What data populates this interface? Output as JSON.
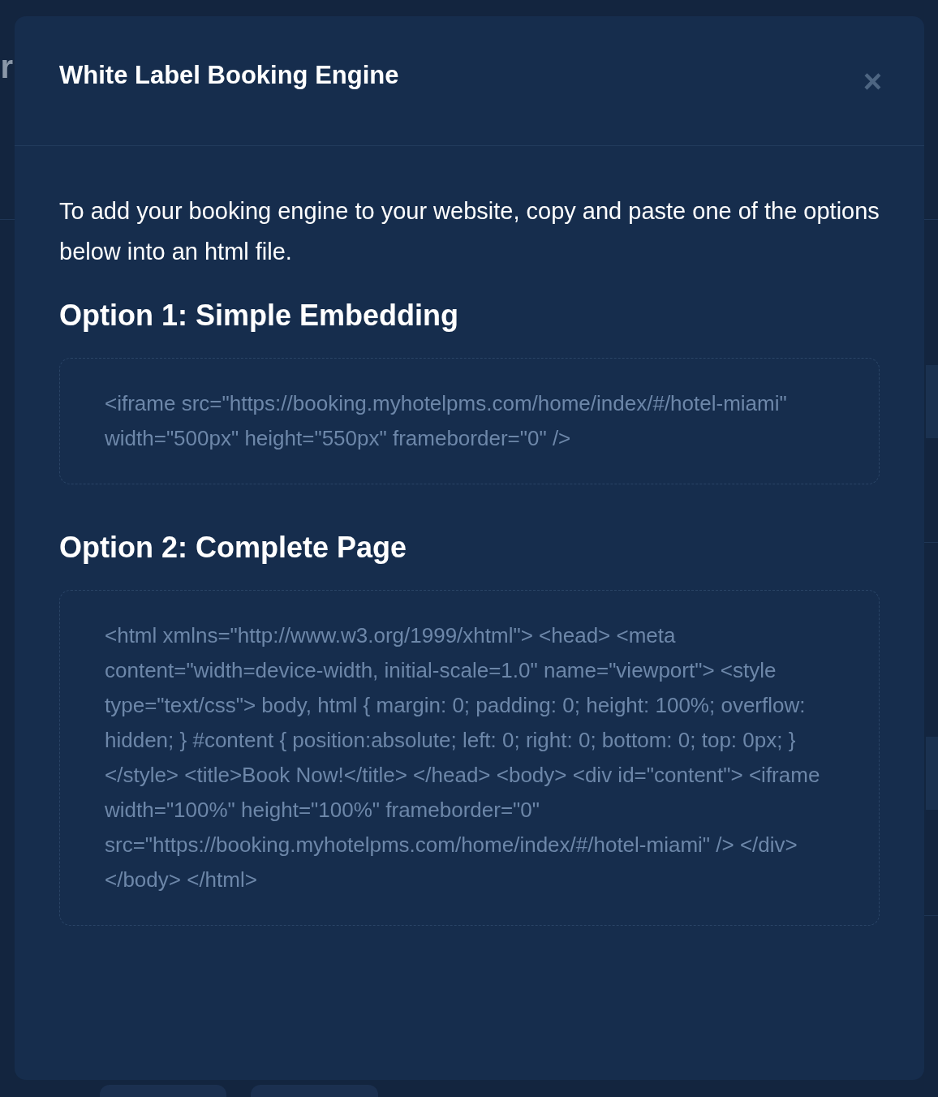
{
  "background": {
    "page_heading_fragment": "r"
  },
  "modal": {
    "title": "White Label Booking Engine",
    "close": "×",
    "intro": "To add your booking engine to your website, copy and paste one of the options below into an html file.",
    "options": [
      {
        "heading": "Option 1: Simple Embedding",
        "code": "<iframe src=\"https://booking.myhotelpms.com/home/index/#/hotel-miami\" width=\"500px\" height=\"550px\" frameborder=\"0\" />"
      },
      {
        "heading": "Option 2: Complete Page",
        "code": "<html xmlns=\"http://www.w3.org/1999/xhtml\"> <head> <meta content=\"width=device-width, initial-scale=1.0\" name=\"viewport\"> <style type=\"text/css\"> body, html { margin: 0; padding: 0; height: 100%; overflow: hidden; } #content { position:absolute; left: 0; right: 0; bottom: 0; top: 0px; } </style> <title>Book Now!</title> </head> <body> <div id=\"content\"> <iframe width=\"100%\" height=\"100%\" frameborder=\"0\" src=\"https://booking.myhotelpms.com/home/index/#/hotel-miami\" /> </div> </body> </html>"
      }
    ]
  }
}
